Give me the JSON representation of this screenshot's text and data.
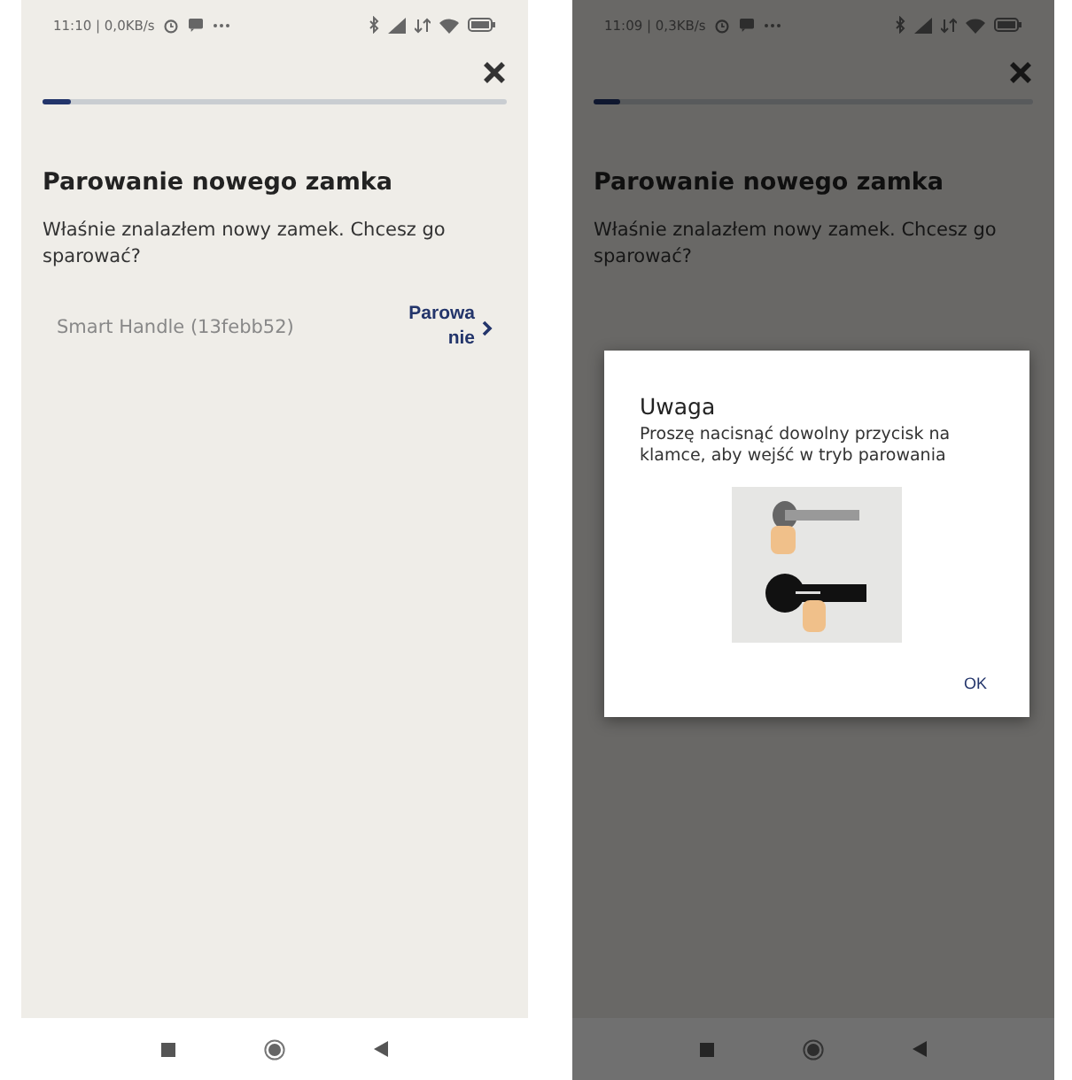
{
  "screens": [
    {
      "status_bar": {
        "time": "11:10 | 0,0KB/s"
      },
      "progress": {
        "level": 0.06
      },
      "title": "Parowanie nowego zamka",
      "message": "Właśnie znalazłem nowy zamek. Chcesz go sparować?",
      "device": {
        "name": "Smart Handle (13febb52)",
        "action": "Parowanie"
      },
      "dimmed": false
    },
    {
      "status_bar": {
        "time": "11:09 | 0,3KB/s"
      },
      "progress": {
        "level": 0.06
      },
      "title": "Parowanie nowego zamka",
      "message": "Właśnie znalazłem nowy zamek. Chcesz go sparować?",
      "dimmed": true,
      "dialog": {
        "title": "Uwaga",
        "message": "Proszę nacisnąć dowolny przycisk na klamce, aby wejść w tryb parowania",
        "button": "OK"
      }
    }
  ]
}
